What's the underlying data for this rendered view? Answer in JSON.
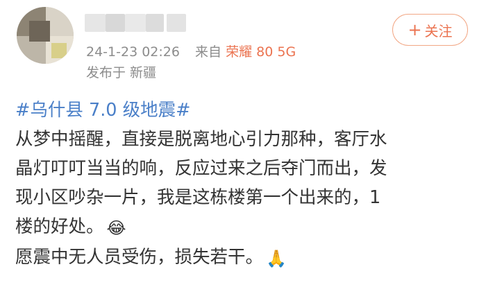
{
  "post": {
    "meta": {
      "timestamp": "24-1-23 02:26",
      "source_prefix": "来自",
      "device": "荣耀 80 5G",
      "location": "发布于 新疆"
    },
    "follow_button": {
      "icon": "plus-icon",
      "label": "关注"
    },
    "content": {
      "hashtag": "#乌什县 7.0 级地震#",
      "line1": "从梦中摇醒，直接是脱离地心引力那种，客厅水",
      "line2": "晶灯叮叮当当的响，反应过来之后夺门而出，发",
      "line3": "现小区吵杂一片，我是这栋楼第一个出来的，1",
      "line4": "楼的好处。",
      "emoji1": "😂",
      "line5": "愿震中无人员受伤，损失若干。",
      "emoji2": "🙏"
    },
    "colors": {
      "accent": "#eb7350",
      "hashtag": "#4a7fc8",
      "meta_text": "#8c8c8c",
      "body_text": "#333333"
    }
  }
}
